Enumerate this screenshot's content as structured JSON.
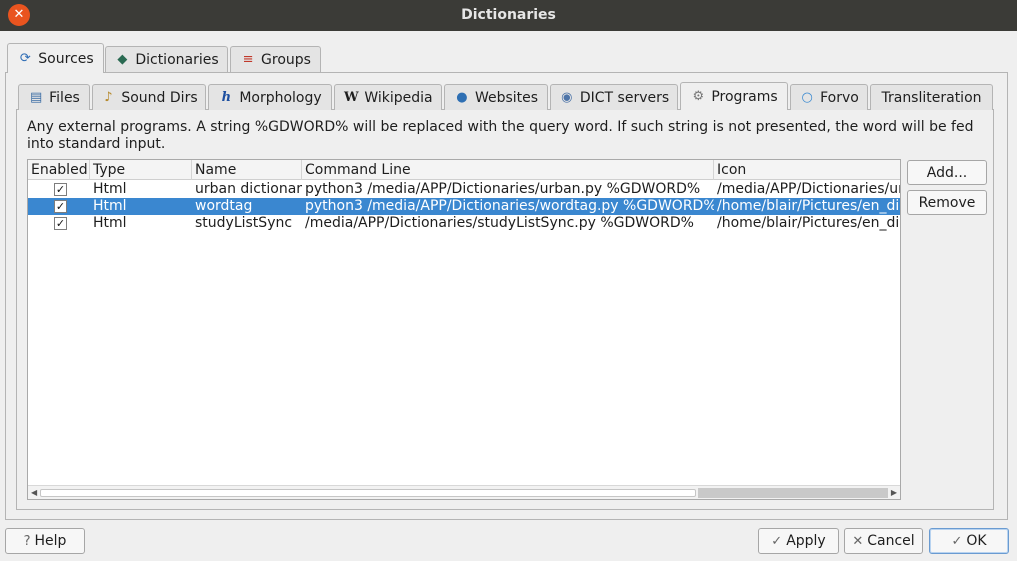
{
  "window": {
    "title": "Dictionaries"
  },
  "top_tabs": [
    {
      "label": "Sources",
      "icon": "refresh-icon"
    },
    {
      "label": "Dictionaries",
      "icon": "book-icon"
    },
    {
      "label": "Groups",
      "icon": "books-stack-icon"
    }
  ],
  "source_tabs": [
    {
      "label": "Files",
      "icon": "file-icon"
    },
    {
      "label": "Sound Dirs",
      "icon": "sound-dir-icon"
    },
    {
      "label": "Morphology",
      "icon": "morphology-h-icon"
    },
    {
      "label": "Wikipedia",
      "icon": "wikipedia-w-icon"
    },
    {
      "label": "Websites",
      "icon": "globe-icon"
    },
    {
      "label": "DICT servers",
      "icon": "dict-server-icon"
    },
    {
      "label": "Programs",
      "icon": "gear-icon"
    },
    {
      "label": "Forvo",
      "icon": "forvo-icon"
    },
    {
      "label": "Transliteration",
      "icon": ""
    }
  ],
  "programs": {
    "description": "Any external programs. A string %GDWORD% will be replaced with the query word. If such string is not presented, the word will be fed into standard input.",
    "columns": [
      "Enabled",
      "Type",
      "Name",
      "Command Line",
      "Icon"
    ],
    "rows": [
      {
        "enabled": "✓",
        "type": "Html",
        "name": "urban dictionary",
        "command": "python3 /media/APP/Dictionaries/urban.py %GDWORD%",
        "icon": "/media/APP/Dictionaries/urban.png",
        "selected": false
      },
      {
        "enabled": "✓",
        "type": "Html",
        "name": "wordtag",
        "command": "python3 /media/APP/Dictionaries/wordtag.py %GDWORD%",
        "icon": "/home/blair/Pictures/en_dict.png",
        "selected": true
      },
      {
        "enabled": "✓",
        "type": "Html",
        "name": "studyListSync",
        "command": "/media/APP/Dictionaries/studyListSync.py %GDWORD%",
        "icon": "/home/blair/Pictures/en_dict.png",
        "selected": false
      }
    ],
    "add_label": "Add...",
    "remove_label": "Remove"
  },
  "footer": {
    "help_label": "Help",
    "apply_label": "Apply",
    "cancel_label": "Cancel",
    "ok_label": "OK"
  },
  "colors": {
    "selection": "#3a87d0",
    "close_button": "#e9541f",
    "titlebar": "#3b3b37"
  }
}
